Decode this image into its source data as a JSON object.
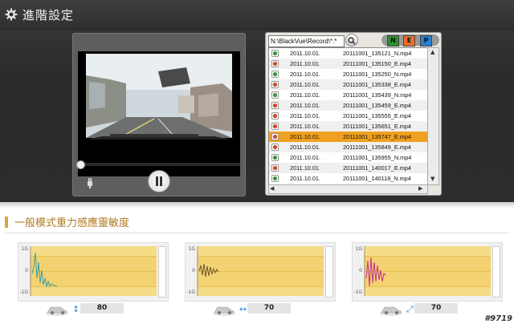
{
  "window": {
    "title": "進階設定"
  },
  "player": {
    "progress": 0.02
  },
  "browser": {
    "path": "N:\\BlackVue\\Record\\*.*",
    "filter_buttons": [
      {
        "label": "N",
        "color": "#2e8f2e"
      },
      {
        "label": "E",
        "color": "#e8702a"
      },
      {
        "label": "P",
        "color": "#2a7fd0"
      }
    ],
    "files": [
      {
        "date": "2011.10.01.",
        "name": "20111001_135121_N.mp4",
        "type": "N"
      },
      {
        "date": "2011.10.01.",
        "name": "20111001_135150_E.mp4",
        "type": "E"
      },
      {
        "date": "2011.10.01.",
        "name": "20111001_135250_N.mp4",
        "type": "N"
      },
      {
        "date": "2011.10.01.",
        "name": "20111001_135338_E.mp4",
        "type": "E"
      },
      {
        "date": "2011.10.01.",
        "name": "20111001_135439_N.mp4",
        "type": "N"
      },
      {
        "date": "2011.10.01.",
        "name": "20111001_135459_E.mp4",
        "type": "E"
      },
      {
        "date": "2011.10.01.",
        "name": "20111001_135555_E.mp4",
        "type": "E"
      },
      {
        "date": "2011.10.01.",
        "name": "20111001_135651_E.mp4",
        "type": "E"
      },
      {
        "date": "2011.10.01.",
        "name": "20111001_135747_E.mp4",
        "type": "E",
        "selected": true
      },
      {
        "date": "2011.10.01.",
        "name": "20111001_135849_E.mp4",
        "type": "E"
      },
      {
        "date": "2011.10.01.",
        "name": "20111001_135955_N.mp4",
        "type": "N"
      },
      {
        "date": "2011.10.01.",
        "name": "20111001_140017_E.mp4",
        "type": "E"
      },
      {
        "date": "2011.10.01.",
        "name": "20111001_140118_N.mp4",
        "type": "N"
      }
    ]
  },
  "sensitivity": {
    "title": "一般模式重力感應靈敏度",
    "graphs": [
      {
        "axis": "↕",
        "axis_icon": "vertical-axis-icon",
        "value": "80",
        "y_top": "1G",
        "y_mid": "0",
        "y_bottom": "-1G",
        "line_color": "#3aa0a8"
      },
      {
        "axis": "↔",
        "axis_icon": "horizontal-axis-icon",
        "value": "70",
        "y_top": "1G",
        "y_mid": "0",
        "y_bottom": "-1G",
        "line_color": "#6a5a2a"
      },
      {
        "axis": "⤢",
        "axis_icon": "diagonal-axis-icon",
        "value": "70",
        "y_top": "1G",
        "y_mid": "0",
        "y_bottom": "-1G",
        "line_color": "#c2308a"
      }
    ]
  },
  "watermark": "#9719"
}
